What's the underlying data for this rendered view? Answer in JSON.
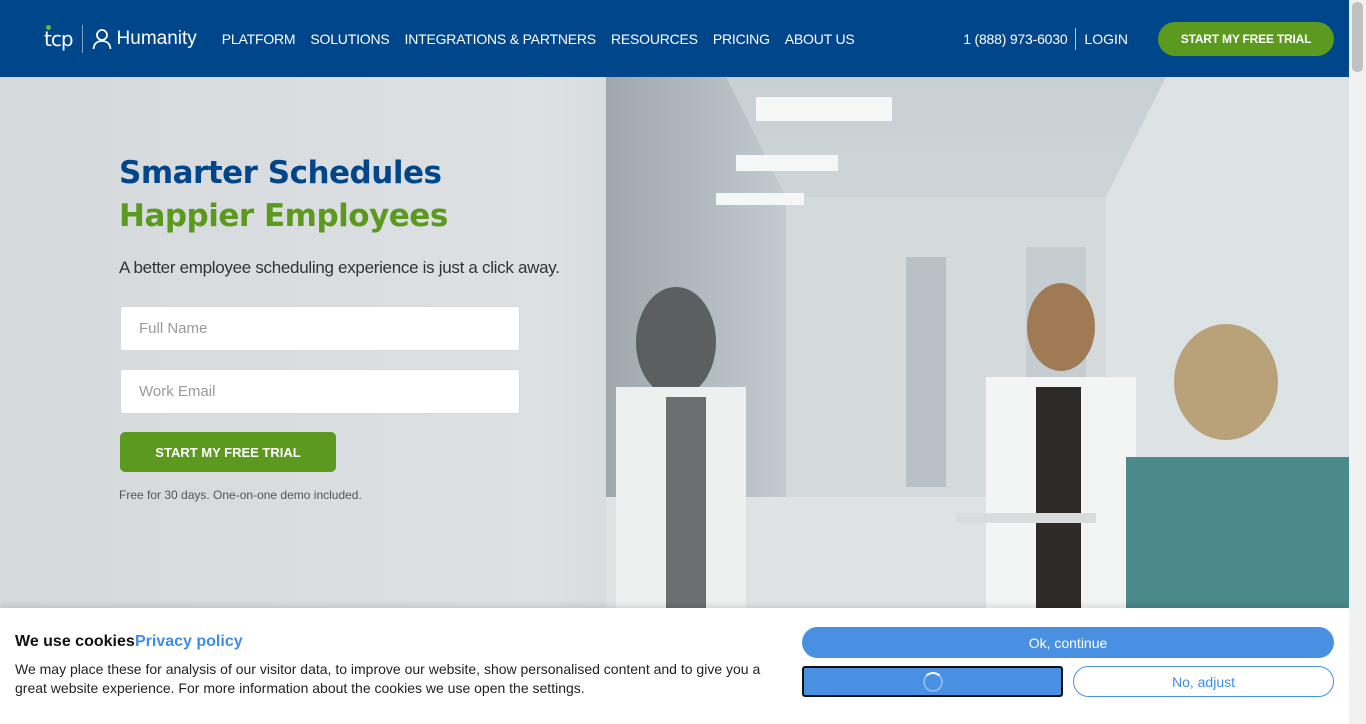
{
  "header": {
    "logo_text": "tcp",
    "brand_name": "Humanity",
    "nav": [
      "PLATFORM",
      "SOLUTIONS",
      "INTEGRATIONS & PARTNERS",
      "RESOURCES",
      "PRICING",
      "ABOUT US"
    ],
    "phone": "1 (888) 973-6030",
    "login": "LOGIN",
    "cta": "START MY FREE TRIAL"
  },
  "hero": {
    "headline_line1": "Smarter Schedules",
    "headline_line2": "Happier Employees",
    "subheadline": "A better employee scheduling experience is just a click away.",
    "full_name_placeholder": "Full Name",
    "work_email_placeholder": "Work Email",
    "cta": "START MY FREE TRIAL",
    "note": "Free for 30 days. One-on-one demo included."
  },
  "cookie_banner": {
    "title": "We use cookies",
    "privacy_link": "Privacy policy",
    "text": "We may place these for analysis of our visitor data, to improve our website, show personalised content and to give you a great website experience. For more information about the cookies we use open the settings.",
    "ok_button": "Ok, continue",
    "adjust_button": "No, adjust"
  },
  "colors": {
    "header_blue": "#00468b",
    "brand_green": "#5b9a1f",
    "cookie_blue": "#4a90e2"
  },
  "icons": [
    "user-icon",
    "loading-spinner-icon"
  ]
}
